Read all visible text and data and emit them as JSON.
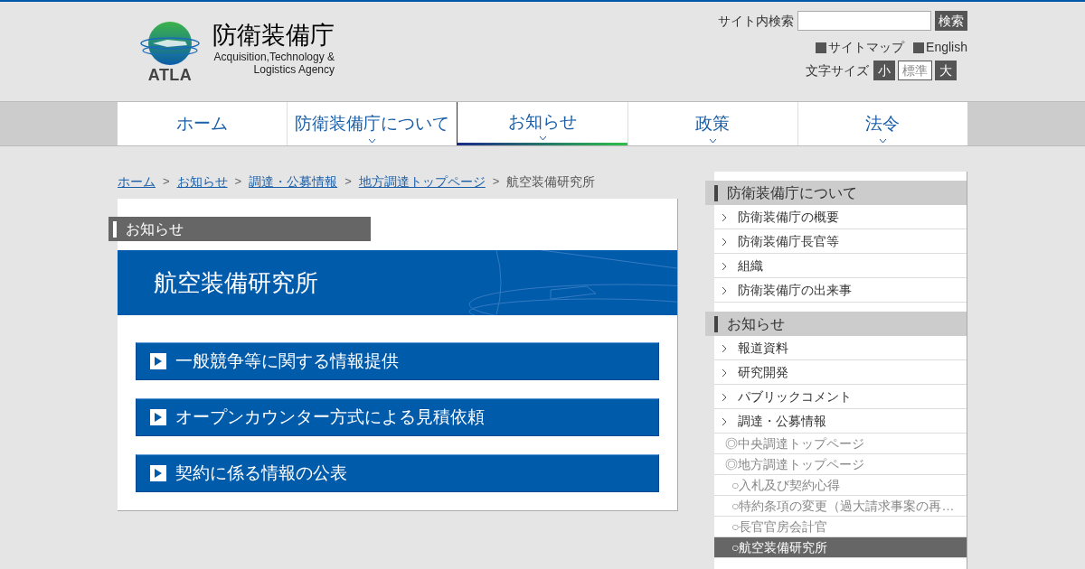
{
  "header": {
    "org_name": "防衛装備庁",
    "org_name_en": "Acquisition,Technology & Logistics Agency",
    "logo_text": "ATLA",
    "search": {
      "label": "サイト内検索",
      "button": "検索"
    },
    "links": [
      "サイトマップ",
      "English"
    ],
    "font_size": {
      "label": "文字サイズ",
      "options": [
        {
          "label": "小",
          "selected": false
        },
        {
          "label": "標準",
          "selected": true
        },
        {
          "label": "大",
          "selected": false
        }
      ]
    }
  },
  "nav": [
    {
      "label": "ホーム",
      "selected": false,
      "dropdown": false
    },
    {
      "label": "防衛装備庁について",
      "selected": false,
      "dropdown": true
    },
    {
      "label": "お知らせ",
      "selected": true,
      "dropdown": true
    },
    {
      "label": "政策",
      "selected": false,
      "dropdown": true
    },
    {
      "label": "法令",
      "selected": false,
      "dropdown": true
    }
  ],
  "breadcrumb_separator": ">",
  "breadcrumb": [
    {
      "label": "ホーム",
      "link": true
    },
    {
      "label": "お知らせ",
      "link": true
    },
    {
      "label": "調達・公募情報",
      "link": true
    },
    {
      "label": "地方調達トップページ",
      "link": true
    },
    {
      "label": "航空装備研究所",
      "link": false
    }
  ],
  "section_label": "お知らせ",
  "page_title": "航空装備研究所",
  "link_buttons": [
    "一般競争等に関する情報提供",
    "オープンカウンター方式による見積依頼",
    "契約に係る情報の公表"
  ],
  "sidebar": [
    {
      "title": "防衛装備庁について",
      "items": [
        {
          "label": "防衛装備庁の概要",
          "kind": "main",
          "selected": false
        },
        {
          "label": "防衛装備庁長官等",
          "kind": "main",
          "selected": false
        },
        {
          "label": "組織",
          "kind": "main",
          "selected": false
        },
        {
          "label": "防衛装備庁の出来事",
          "kind": "main",
          "selected": false
        }
      ]
    },
    {
      "title": "お知らせ",
      "items": [
        {
          "label": "報道資料",
          "kind": "main",
          "selected": false
        },
        {
          "label": "研究開発",
          "kind": "main",
          "selected": false
        },
        {
          "label": "パブリックコメント",
          "kind": "main",
          "selected": false
        },
        {
          "label": "調達・公募情報",
          "kind": "main",
          "selected": false
        },
        {
          "label": "◎中央調達トップページ",
          "kind": "sub",
          "selected": false
        },
        {
          "label": "◎地方調達トップページ",
          "kind": "sub",
          "selected": false
        },
        {
          "label": "○入札及び契約心得",
          "kind": "subsub",
          "selected": false
        },
        {
          "label": "○特約条項の変更（過大請求事案の再…",
          "kind": "subsub",
          "selected": false
        },
        {
          "label": "○長官官房会計官",
          "kind": "subsub",
          "selected": false
        },
        {
          "label": "○航空装備研究所",
          "kind": "subsub",
          "selected": true
        }
      ]
    }
  ]
}
